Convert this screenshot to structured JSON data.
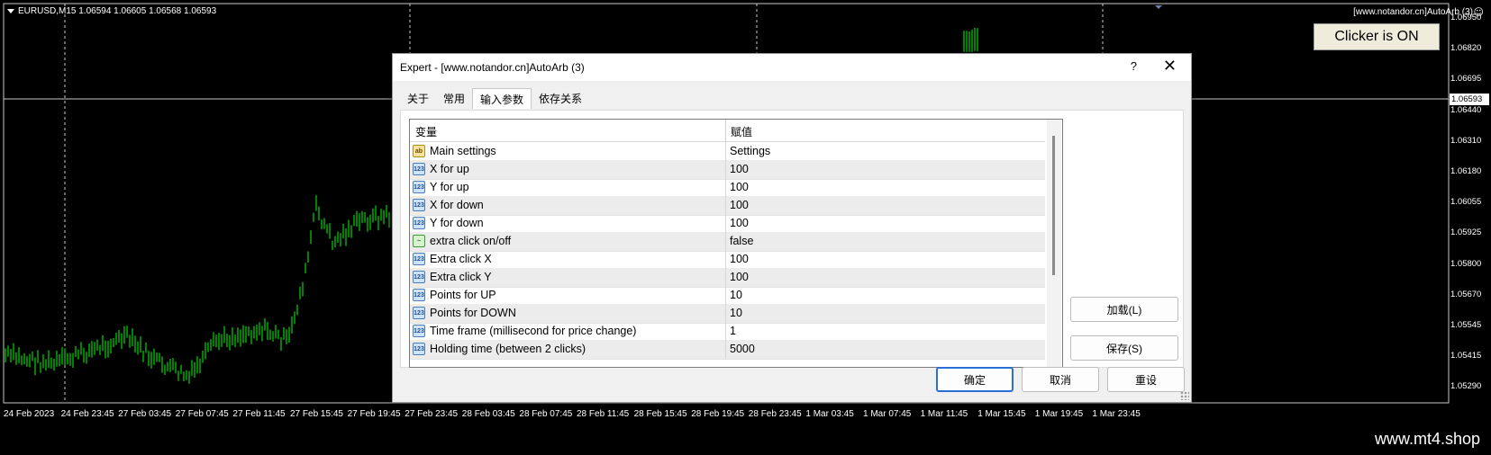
{
  "chart": {
    "symbol_info": "EURUSD,M15  1.06594 1.06605 1.06568 1.06593",
    "ea_label": "[www.notandor.cn]AutoArb (3)",
    "clicker_label": "Clicker is ON",
    "current_price": "1.06593",
    "price_labels": [
      "1.06950",
      "1.06820",
      "1.06695",
      "1.06440",
      "1.06310",
      "1.06180",
      "1.06055",
      "1.05925",
      "1.05800",
      "1.05670",
      "1.05545",
      "1.05415",
      "1.05290"
    ],
    "time_labels": [
      "24 Feb 2023",
      "24 Feb 23:45",
      "27 Feb 03:45",
      "27 Feb 07:45",
      "27 Feb 11:45",
      "27 Feb 15:45",
      "27 Feb 19:45",
      "27 Feb 23:45",
      "28 Feb 03:45",
      "28 Feb 07:45",
      "28 Feb 11:45",
      "28 Feb 15:45",
      "28 Feb 19:45",
      "28 Feb 23:45",
      "1 Mar 03:45",
      "1 Mar 07:45",
      "1 Mar 11:45",
      "1 Mar 15:45",
      "1 Mar 19:45",
      "1 Mar 23:45"
    ],
    "colors": {
      "background": "#000000",
      "candles": "#00ff00",
      "grid": "#c8c8c8"
    }
  },
  "dialog": {
    "title": "Expert - [www.notandor.cn]AutoArb (3)",
    "help": "?",
    "close": "✕",
    "tabs": [
      {
        "label": "关于",
        "active": false
      },
      {
        "label": "常用",
        "active": false
      },
      {
        "label": "输入参数",
        "active": true
      },
      {
        "label": "依存关系",
        "active": false
      }
    ],
    "grid": {
      "header_variable": "变量",
      "header_value": "赋值",
      "rows": [
        {
          "name": "Main settings",
          "value": "Settings",
          "type": "ab"
        },
        {
          "name": "X for up",
          "value": "100",
          "type": "123"
        },
        {
          "name": "Y for up",
          "value": "100",
          "type": "123"
        },
        {
          "name": "X for down",
          "value": "100",
          "type": "123"
        },
        {
          "name": "Y for down",
          "value": "100",
          "type": "123"
        },
        {
          "name": "extra click on/off",
          "value": "false",
          "type": "bool"
        },
        {
          "name": "Extra click X",
          "value": "100",
          "type": "123"
        },
        {
          "name": "Extra click Y",
          "value": "100",
          "type": "123"
        },
        {
          "name": "Points for UP",
          "value": "10",
          "type": "123"
        },
        {
          "name": "Points for DOWN",
          "value": "10",
          "type": "123"
        },
        {
          "name": "Time frame (millisecond for price change)",
          "value": "1",
          "type": "123"
        },
        {
          "name": "Holding time (between 2 clicks)",
          "value": "5000",
          "type": "123"
        }
      ]
    },
    "buttons": {
      "load": "加载(L)",
      "save": "保存(S)",
      "ok": "确定",
      "cancel": "取消",
      "reset": "重设"
    }
  },
  "watermark": "www.mt4.shop"
}
